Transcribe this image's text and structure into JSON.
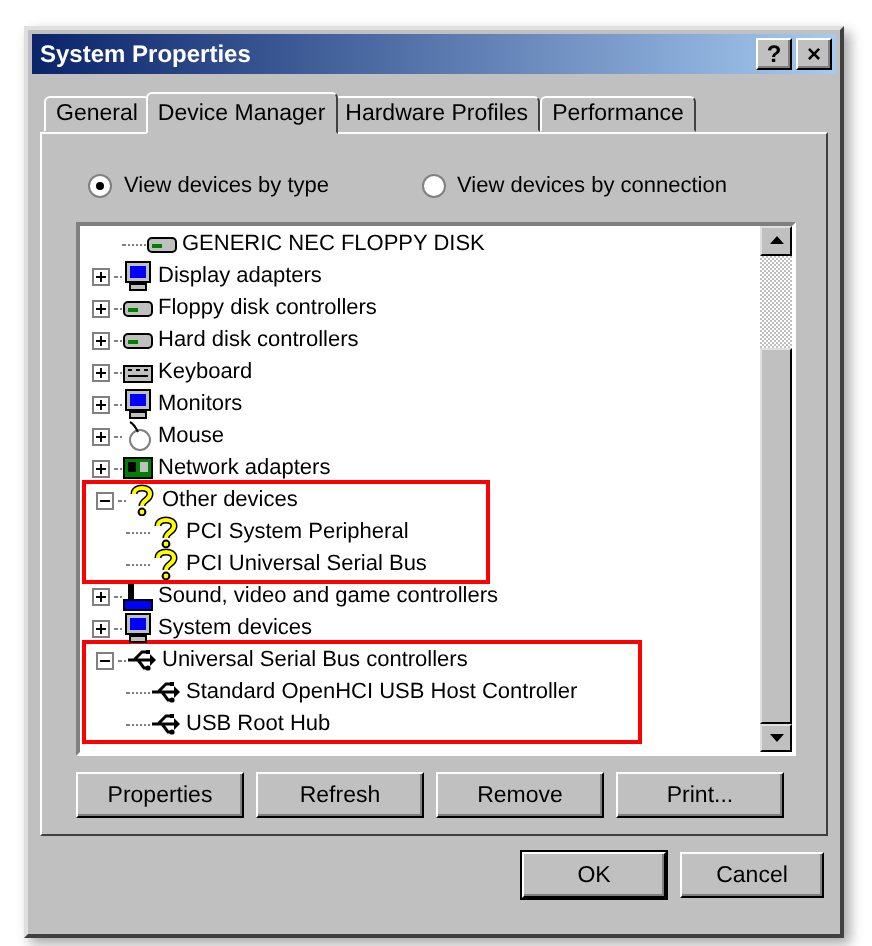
{
  "window": {
    "title": "System Properties",
    "controls": [
      "?",
      "×"
    ]
  },
  "tabs": [
    {
      "label": "General",
      "selected": false
    },
    {
      "label": "Device Manager",
      "selected": true
    },
    {
      "label": "Hardware Profiles",
      "selected": false
    },
    {
      "label": "Performance",
      "selected": false
    }
  ],
  "view_options": [
    {
      "label": "View devices by type",
      "selected": true
    },
    {
      "label": "View devices by connection",
      "selected": false
    }
  ],
  "tree": [
    {
      "children": [
        {
          "label": "GENERIC NEC  FLOPPY DISK",
          "kind": "drive"
        }
      ]
    },
    {
      "label": "Display adapters",
      "kind": "monitor",
      "expanded": false,
      "highlighted": false
    },
    {
      "label": "Floppy disk controllers",
      "kind": "drive",
      "expanded": false,
      "highlighted": false
    },
    {
      "label": "Hard disk controllers",
      "kind": "drive",
      "expanded": false,
      "highlighted": false
    },
    {
      "label": "Keyboard",
      "kind": "keyboard",
      "expanded": false,
      "highlighted": false
    },
    {
      "label": "Monitors",
      "kind": "monitor",
      "expanded": false,
      "highlighted": false
    },
    {
      "label": "Mouse",
      "kind": "mouse",
      "expanded": false,
      "highlighted": false
    },
    {
      "label": "Network adapters",
      "kind": "network",
      "expanded": false,
      "highlighted": false
    },
    {
      "label": "Other devices",
      "kind": "question",
      "expanded": true,
      "highlighted": true,
      "children": [
        {
          "label": "PCI System Peripheral",
          "kind": "question"
        },
        {
          "label": "PCI Universal Serial Bus",
          "kind": "question"
        }
      ]
    },
    {
      "label": "Sound, video and game controllers",
      "kind": "sound",
      "expanded": false,
      "highlighted": false
    },
    {
      "label": "System devices",
      "kind": "monitor",
      "expanded": false,
      "highlighted": false
    },
    {
      "label": "Universal Serial Bus controllers",
      "kind": "usb",
      "expanded": true,
      "highlighted": true,
      "children": [
        {
          "label": "Standard OpenHCI USB Host Controller",
          "kind": "usb"
        },
        {
          "label": "USB Root Hub",
          "kind": "usb"
        }
      ]
    }
  ],
  "actions": [
    "Properties",
    "Refresh",
    "Remove",
    "Print..."
  ],
  "footer_buttons": [
    {
      "label": "OK",
      "default": true
    },
    {
      "label": "Cancel",
      "default": false
    }
  ]
}
